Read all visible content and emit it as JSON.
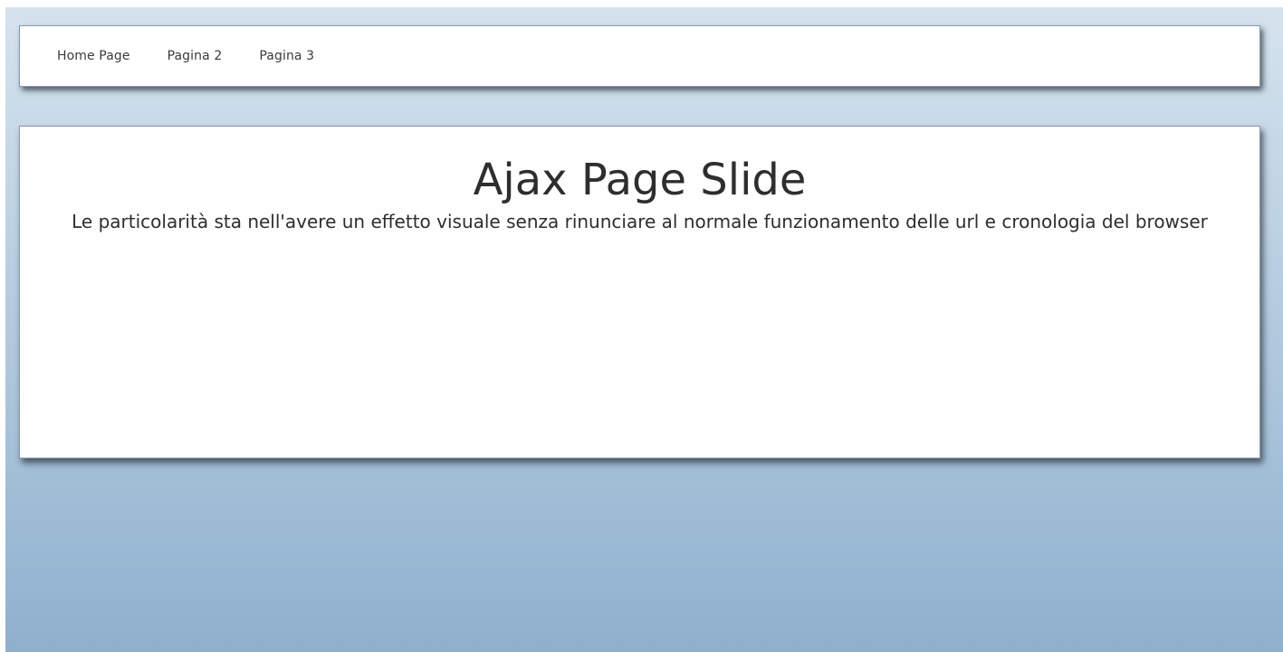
{
  "nav": {
    "items": [
      {
        "label": "Home Page"
      },
      {
        "label": "Pagina 2"
      },
      {
        "label": "Pagina 3"
      }
    ]
  },
  "content": {
    "title": "Ajax Page Slide",
    "description": "Le particolarità sta nell'avere un effetto visuale senza rinunciare al normale funzionamento delle url e cronologia del browser"
  },
  "colors": {
    "background_top": "#d5e3ee",
    "background_bottom": "#8fb0cd",
    "panel": "#ffffff",
    "text": "#2e2e2e"
  }
}
